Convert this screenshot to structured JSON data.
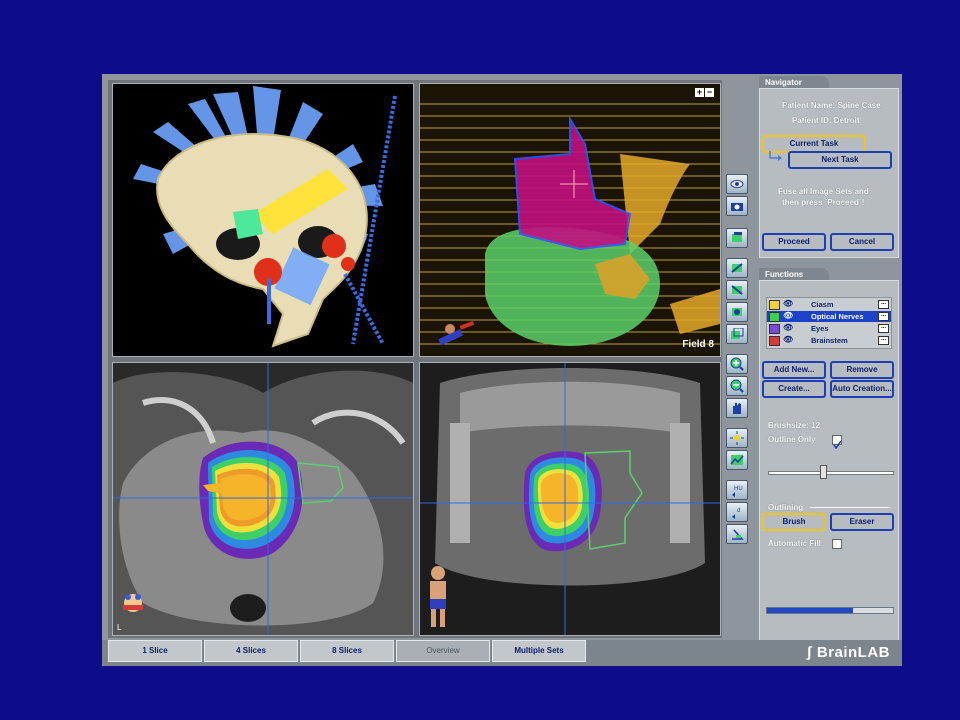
{
  "viewports": {
    "field_label": "Field 8",
    "zoom_plus": "+",
    "zoom_minus": "−",
    "corner_letter": "L"
  },
  "navigator": {
    "tab_label": "Navigator",
    "patient_name": "Patient Name: Spine Case",
    "patient_id": "Patient ID: Detroit",
    "current_task": "Current Task",
    "next_task": "Next Task",
    "instruction_line1": "Fuse all Image Sets and",
    "instruction_line2": "then press `Proceed´!",
    "proceed": "Proceed",
    "cancel": "Cancel"
  },
  "functions": {
    "tab_label": "Functions",
    "objects": [
      {
        "name": "Ciasm",
        "color": "#f2d23c",
        "selected": false
      },
      {
        "name": "Optical Nerves",
        "color": "#3bd24a",
        "selected": true
      },
      {
        "name": "Eyes",
        "color": "#7a4ad8",
        "selected": false
      },
      {
        "name": "Brainstem",
        "color": "#d83a3a",
        "selected": false
      }
    ],
    "dots_label": "...",
    "add_new": "Add New...",
    "remove": "Remove",
    "create": "Create...",
    "auto_creation": "Auto Creation...",
    "brushsize": "Brushsize:  12",
    "outline_only": "Outline Only",
    "outline_checked": true,
    "brush_level": 0.43,
    "outlining": "Outlining",
    "brush": "Brush",
    "eraser": "Eraser",
    "automatic_fill": "Automatic Fill",
    "automatic_fill_checked": false,
    "progress": 0.68
  },
  "bottom_tabs": [
    "1 Slice",
    "4 Slices",
    "8 Slices",
    "Overview",
    "Multiple Sets"
  ],
  "active_tab": "Overview",
  "logo": "BrainLAB",
  "colors": {
    "background": "#0d0d8c",
    "accent_blue": "#1c42c8",
    "yellow_highlight": "#f2c31a"
  },
  "icons": {
    "eye": "eye-icon",
    "camera": "camera-icon",
    "dots": "more-icon"
  }
}
